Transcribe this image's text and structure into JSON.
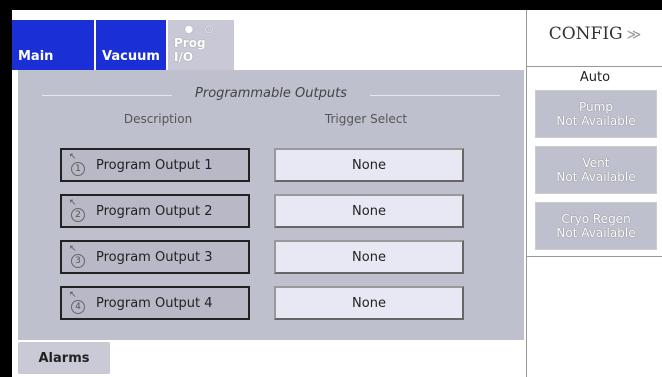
{
  "tabs": {
    "main": "Main",
    "vacuum": "Vacuum",
    "prog_io": "Prog I/O",
    "prog_dots": "● ○"
  },
  "section": {
    "title": "Programmable Outputs",
    "col_description": "Description",
    "col_trigger": "Trigger Select"
  },
  "outputs": [
    {
      "num": "1",
      "label": "Program Output 1",
      "trigger": "None"
    },
    {
      "num": "2",
      "label": "Program Output 2",
      "trigger": "None"
    },
    {
      "num": "3",
      "label": "Program Output 3",
      "trigger": "None"
    },
    {
      "num": "4",
      "label": "Program Output 4",
      "trigger": "None"
    }
  ],
  "alarms_label": "Alarms",
  "side": {
    "config_label": "CONFIG",
    "chevron": "≫",
    "mode": "Auto",
    "buttons": [
      {
        "line1": "Pump",
        "line2": "Not Available"
      },
      {
        "line1": "Vent",
        "line2": "Not Available"
      },
      {
        "line1": "Cryo Regen",
        "line2": "Not Available"
      }
    ]
  },
  "colors": {
    "tab_active_blue": "#1b2fd6",
    "panel_gray": "#bfc0ce",
    "button_light": "#e8e8f4"
  }
}
